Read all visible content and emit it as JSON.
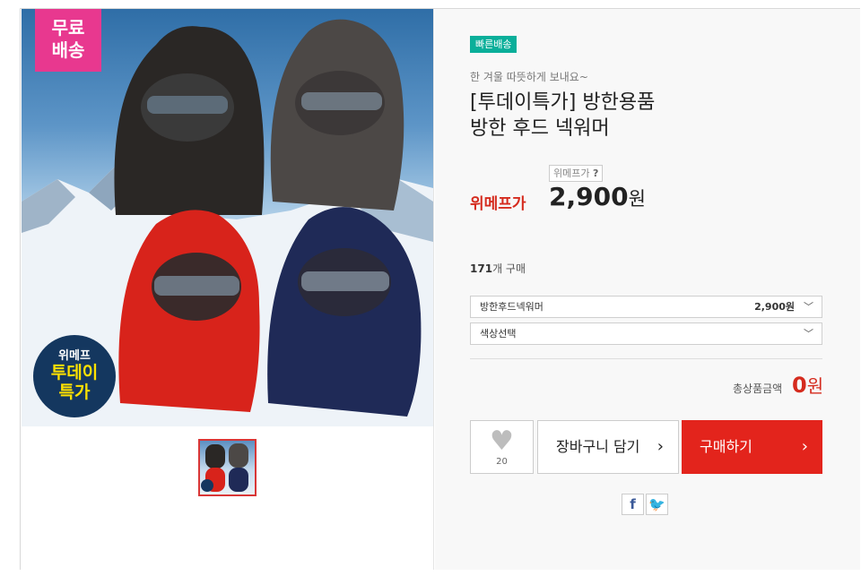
{
  "product_image": {
    "free_shipping_badge": "무료\n배송",
    "promo_badge": {
      "line1": "위메프",
      "line2": "투데이",
      "line3": "특가"
    },
    "hood_colors": [
      "#2a2725",
      "#4c4846",
      "#d8231b",
      "#1f2a57"
    ]
  },
  "info": {
    "fast_delivery_tag": "빠른배송",
    "subtitle": "한 겨울 따뜻하게 보내요~",
    "title_line1": "[투데이특가] 방한용품",
    "title_line2": "방한 후드 넥워머",
    "price_help": "위메프가",
    "price_help_icon": "?",
    "price_label": "위메프가",
    "price": "2,900",
    "price_unit": "원",
    "buy_count": "171",
    "buy_count_suffix": "개 구매"
  },
  "options": {
    "product_select": {
      "label": "방한후드넥워머",
      "price": "2,900원"
    },
    "color_select": {
      "label": "색상선택"
    }
  },
  "total": {
    "label": "총상품금액",
    "value": "0",
    "unit": "원"
  },
  "actions": {
    "like_count": "20",
    "cart_label": "장바구니 담기",
    "buy_label": "구매하기"
  },
  "share": {
    "facebook": "f",
    "twitter": "🐦"
  },
  "colors": {
    "accent_red": "#e3241c",
    "price_red": "#d52b1e",
    "teal": "#0aaf9a",
    "pink": "#e8388f"
  }
}
